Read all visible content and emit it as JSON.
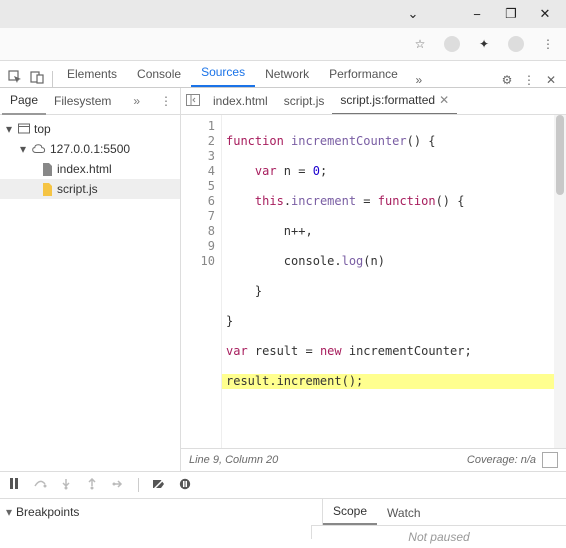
{
  "devtools": {
    "tabs": [
      "Elements",
      "Console",
      "Sources",
      "Network",
      "Performance"
    ],
    "activeTab": "Sources"
  },
  "sideTabs": {
    "page": "Page",
    "filesystem": "Filesystem"
  },
  "tree": {
    "top": "top",
    "origin": "127.0.0.1:5500",
    "files": [
      "index.html",
      "script.js"
    ]
  },
  "fileTabs": {
    "f1": "index.html",
    "f2": "script.js",
    "f3": "script.js:formatted"
  },
  "code": {
    "lines": [
      1,
      2,
      3,
      4,
      5,
      6,
      7,
      8,
      9,
      10
    ],
    "l1a": "function ",
    "l1b": "incrementCounter",
    "l1c": "() {",
    "l2a": "    var ",
    "l2b": "n",
    "l2c": " = ",
    "l2d": "0",
    "l2e": ";",
    "l3a": "    ",
    "l3b": "this",
    "l3c": ".",
    "l3d": "increment",
    "l3e": " = ",
    "l3f": "function",
    "l3g": "() {",
    "l4": "        n++,",
    "l5a": "        console.",
    "l5b": "log",
    "l5c": "(n)",
    "l6": "    }",
    "l7": "}",
    "l8a": "var ",
    "l8b": "result",
    "l8c": " = ",
    "l8d": "new ",
    "l8e": "incrementCounter;",
    "l9": "result.increment();"
  },
  "status": {
    "pos": "Line 9, Column 20",
    "cov": "Coverage: n/a"
  },
  "lower": {
    "bp": "Breakpoints",
    "scope": "Scope",
    "watch": "Watch",
    "np": "Not paused"
  }
}
